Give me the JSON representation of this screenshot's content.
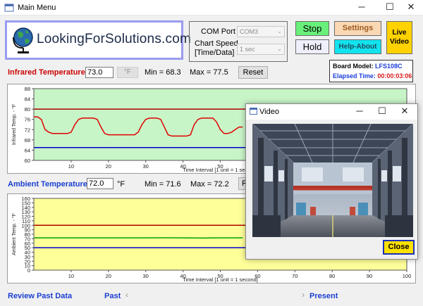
{
  "window": {
    "title": "Main Menu",
    "minimize": "─",
    "maximize": "☐",
    "close": "✕"
  },
  "logo": {
    "text": "LookingForSolutions.com",
    "icon": "globe-icon"
  },
  "settings": {
    "com_port_label": "COM Port",
    "com_port_value": "COM3",
    "chart_speed_label_1": "Chart Speed",
    "chart_speed_label_2": "[Time/Data]",
    "chart_speed_value": "1 sec"
  },
  "buttons": {
    "stop": "Stop",
    "hold": "Hold",
    "settings": "Settings",
    "help_about": "Help-About",
    "live_video_1": "Live",
    "live_video_2": "Video"
  },
  "board": {
    "model_label": "Board Model:",
    "model_value": "LFS108C",
    "elapsed_label": "Elapsed Time:",
    "elapsed_value": "00:00:03:06"
  },
  "infrared": {
    "title": "Infrared Temperature",
    "value": "73.0",
    "unit": "°F",
    "min": "Min = 68.3",
    "max": "Max = 77.5",
    "reset": "Reset"
  },
  "ambient": {
    "title": "Ambient Temperature",
    "value": "72.0",
    "unit": "°F",
    "min": "Min = 71.6",
    "max": "Max = 72.2",
    "reset_partial": "R"
  },
  "bottom": {
    "review": "Review Past Data",
    "past": "Past",
    "present": "Present",
    "left_arrow": "‹",
    "right_arrow": "›"
  },
  "video_window": {
    "title": "Video",
    "minimize": "─",
    "maximize": "☐",
    "close": "✕",
    "close_button": "Close"
  },
  "colors": {
    "infrared_title": "#cc0000",
    "ambient_title": "#1a3fd0",
    "ir_plot_bg": "#c8f5c8",
    "amb_plot_bg": "#ffff99",
    "max_line": "#b00000",
    "min_line": "#0000cc",
    "data_line": "#e00000",
    "amb_data_line": "#00a000"
  },
  "chart_data": [
    {
      "type": "line",
      "title": "",
      "xlabel": "Time Interval [1 unit = 1 second]",
      "ylabel": "Infrared Temp. - °F",
      "xlim": [
        0,
        100
      ],
      "ylim": [
        60,
        88
      ],
      "x_ticks": [
        10,
        20,
        30,
        40,
        50
      ],
      "y_ticks": [
        60,
        64,
        68,
        72,
        76,
        80,
        84,
        88
      ],
      "grid": false,
      "upper_limit": 80,
      "lower_limit": 65,
      "series": [
        {
          "x": [
            0,
            1,
            2,
            3,
            4,
            5,
            6,
            7,
            8,
            9,
            10,
            11,
            12,
            13,
            14,
            15,
            16,
            17,
            18,
            19,
            20,
            21,
            22,
            23,
            24,
            25,
            26,
            27,
            28,
            29,
            30,
            31,
            32,
            33,
            34,
            35,
            36,
            37,
            38,
            39,
            40,
            41,
            42,
            43,
            44,
            45,
            46,
            47,
            48,
            49,
            50,
            51,
            52,
            53,
            54,
            55,
            56
          ],
          "y": [
            77,
            77,
            76,
            72,
            71,
            70.5,
            70.5,
            70.5,
            70.5,
            70.5,
            71,
            74,
            76,
            76.5,
            76.5,
            76.5,
            76.5,
            76,
            73,
            70.5,
            70,
            70,
            70,
            70,
            70,
            70,
            70,
            70,
            71,
            74,
            76,
            76.5,
            76.5,
            76.5,
            76,
            73,
            70,
            69.5,
            69.5,
            69.5,
            69.5,
            69.5,
            70,
            74,
            76,
            76.5,
            76.5,
            76.5,
            76.5,
            75,
            72,
            70.5,
            70.5,
            71,
            72,
            73,
            73
          ]
        }
      ]
    },
    {
      "type": "line",
      "title": "",
      "xlabel": "Time Interval [1 unit = 1 second]",
      "ylabel": "Ambient Temp. - °F",
      "xlim": [
        0,
        100
      ],
      "ylim": [
        0,
        160
      ],
      "x_ticks": [
        10,
        20,
        30,
        40,
        50,
        60,
        70,
        80,
        90,
        100
      ],
      "y_ticks": [
        0,
        10,
        20,
        30,
        40,
        50,
        60,
        70,
        80,
        90,
        100,
        110,
        120,
        130,
        140,
        150,
        160
      ],
      "grid": false,
      "upper_limit": 100,
      "lower_limit": 50,
      "series": [
        {
          "x": [
            0,
            10,
            20,
            30,
            35,
            40,
            45,
            50,
            56
          ],
          "y": [
            72,
            72,
            72,
            72,
            72.2,
            72,
            71.6,
            72,
            72
          ]
        }
      ]
    }
  ]
}
